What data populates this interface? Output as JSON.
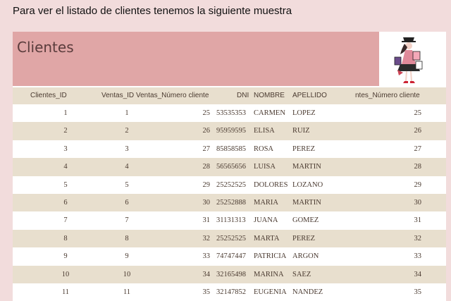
{
  "caption": "Para ver el listado de clientes tenemos la siguiente muestra",
  "report": {
    "title": "Clientes",
    "logo_icon": "woman-with-shopping-bags-icon",
    "columns": [
      "Clientes_ID",
      "Ventas_ID",
      "Ventas_Número cliente",
      "DNI",
      "NOMBRE",
      "APELLIDO",
      "ntes_Número cliente"
    ],
    "rows": [
      [
        "1",
        "1",
        "25",
        "53535353",
        "CARMEN",
        "LOPEZ",
        "25"
      ],
      [
        "2",
        "2",
        "26",
        "95959595",
        "ELISA",
        "RUIZ",
        "26"
      ],
      [
        "3",
        "3",
        "27",
        "85858585",
        "ROSA",
        "PEREZ",
        "27"
      ],
      [
        "4",
        "4",
        "28",
        "56565656",
        "LUISA",
        "MARTIN",
        "28"
      ],
      [
        "5",
        "5",
        "29",
        "25252525",
        "DOLORES",
        "LOZANO",
        "29"
      ],
      [
        "6",
        "6",
        "30",
        "25252888",
        "MARIA",
        "MARTIN",
        "30"
      ],
      [
        "7",
        "7",
        "31",
        "31131313",
        "JUANA",
        "GOMEZ",
        "31"
      ],
      [
        "8",
        "8",
        "32",
        "25252525",
        "MARTA",
        "PEREZ",
        "32"
      ],
      [
        "9",
        "9",
        "33",
        "74747447",
        "PATRICIA",
        "ARGON",
        "33"
      ],
      [
        "10",
        "10",
        "34",
        "32165498",
        "MARINA",
        "SAEZ",
        "34"
      ],
      [
        "11",
        "11",
        "35",
        "32147852",
        "EUGENIA",
        "NANDEZ",
        "35"
      ]
    ]
  }
}
